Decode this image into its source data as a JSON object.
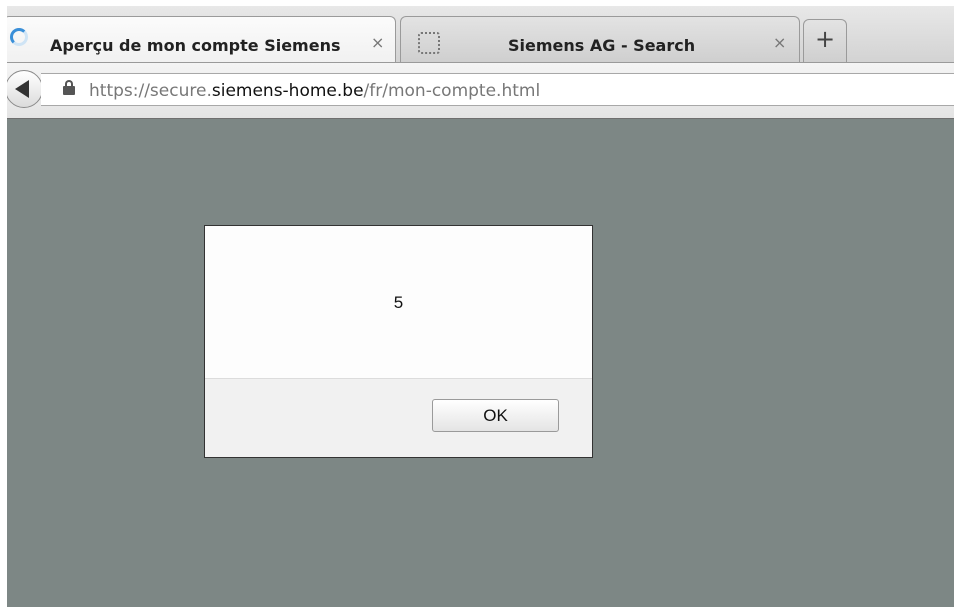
{
  "tabs": [
    {
      "title": "Aperçu de mon compte Siemens",
      "close": "×",
      "icon": "loading-spinner-icon",
      "active": true
    },
    {
      "title": "Siemens AG - Search",
      "close": "×",
      "icon": "blank-page-icon",
      "active": false
    }
  ],
  "new_tab": {
    "label": "+"
  },
  "navbar": {
    "back_icon": "back-arrow-icon",
    "secure_icon": "lock-icon",
    "url": {
      "prefix": "https://secure.",
      "domain": "siemens-home.be",
      "path": "/fr/mon-compte.html"
    }
  },
  "dialog": {
    "message": "5",
    "ok_label": "OK"
  },
  "colors": {
    "page_background": "#7d8785",
    "spinner_accent": "#3a8fd8"
  }
}
